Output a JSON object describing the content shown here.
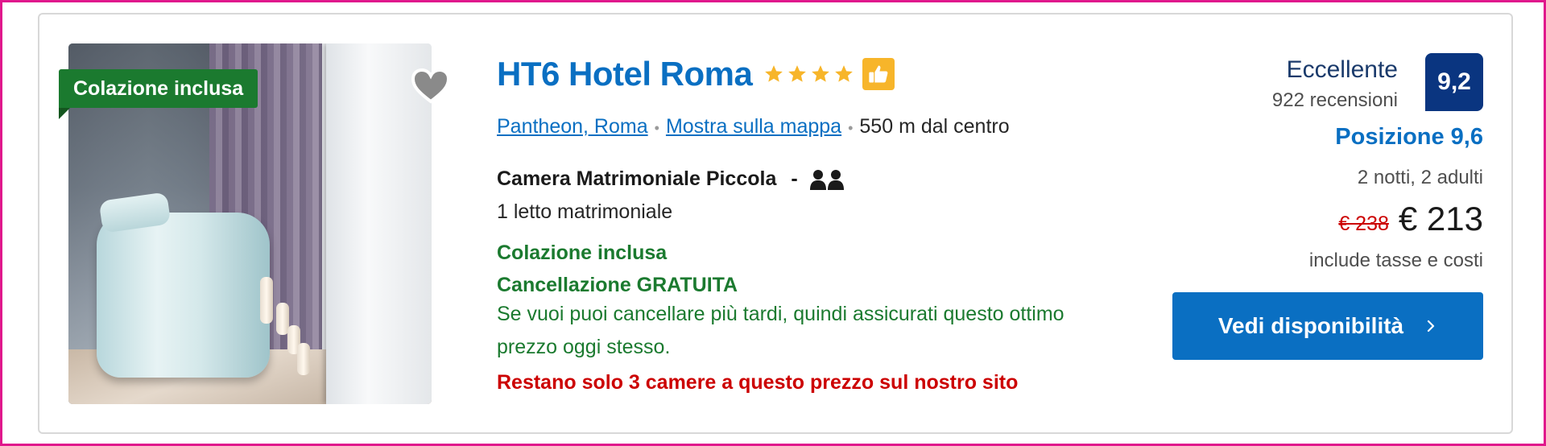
{
  "badge": {
    "label": "Colazione inclusa"
  },
  "hotel": {
    "name": "HT6 Hotel Roma",
    "stars": 4,
    "location_link": "Pantheon, Roma",
    "map_link": "Mostra sulla mappa",
    "distance": "550 m dal centro"
  },
  "room": {
    "name": "Camera Matrimoniale Piccola",
    "dash": "-",
    "occupancy_icon": "two-people-icon",
    "bed": "1 letto matrimoniale"
  },
  "perks": {
    "breakfast": "Colazione inclusa",
    "cancellation": "Cancellazione GRATUITA",
    "cancellation_note": "Se vuoi puoi cancellare più tardi, quindi assicurati questo ottimo prezzo oggi stesso.",
    "scarcity": "Restano solo 3 camere a questo prezzo sul nostro sito"
  },
  "rating": {
    "word": "Eccellente",
    "reviews": "922 recensioni",
    "score": "9,2",
    "location_score": "Posizione 9,6"
  },
  "pricing": {
    "stay": "2 notti, 2 adulti",
    "old_price": "€ 238",
    "price": "€ 213",
    "taxes_note": "include tasse e costi"
  },
  "cta": {
    "label": "Vedi disponibilità"
  },
  "colors": {
    "accent_blue": "#0a6fc2",
    "score_navy": "#0a3580",
    "badge_green": "#1b7a2f",
    "alert_red": "#cc0000",
    "star_yellow": "#f7b52a",
    "frame_pink": "#e0188c"
  }
}
